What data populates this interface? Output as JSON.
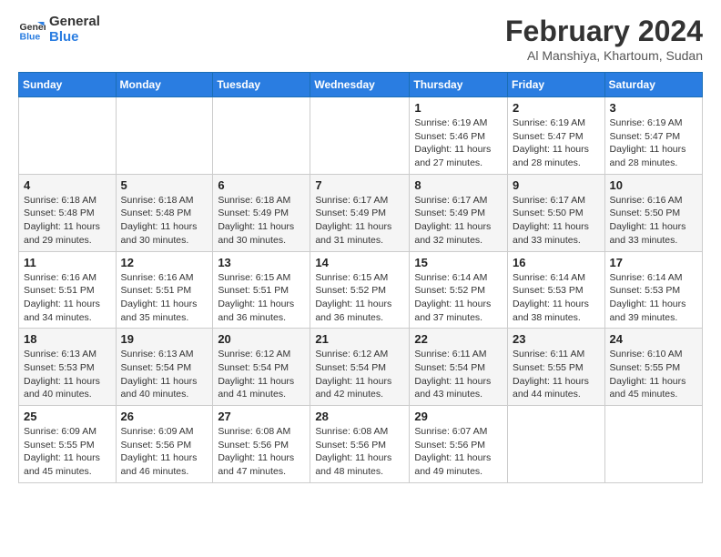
{
  "header": {
    "logo_line1": "General",
    "logo_line2": "Blue",
    "month_year": "February 2024",
    "location": "Al Manshiya, Khartoum, Sudan"
  },
  "weekdays": [
    "Sunday",
    "Monday",
    "Tuesday",
    "Wednesday",
    "Thursday",
    "Friday",
    "Saturday"
  ],
  "weeks": [
    [
      {
        "day": "",
        "info": ""
      },
      {
        "day": "",
        "info": ""
      },
      {
        "day": "",
        "info": ""
      },
      {
        "day": "",
        "info": ""
      },
      {
        "day": "1",
        "info": "Sunrise: 6:19 AM\nSunset: 5:46 PM\nDaylight: 11 hours\nand 27 minutes."
      },
      {
        "day": "2",
        "info": "Sunrise: 6:19 AM\nSunset: 5:47 PM\nDaylight: 11 hours\nand 28 minutes."
      },
      {
        "day": "3",
        "info": "Sunrise: 6:19 AM\nSunset: 5:47 PM\nDaylight: 11 hours\nand 28 minutes."
      }
    ],
    [
      {
        "day": "4",
        "info": "Sunrise: 6:18 AM\nSunset: 5:48 PM\nDaylight: 11 hours\nand 29 minutes."
      },
      {
        "day": "5",
        "info": "Sunrise: 6:18 AM\nSunset: 5:48 PM\nDaylight: 11 hours\nand 30 minutes."
      },
      {
        "day": "6",
        "info": "Sunrise: 6:18 AM\nSunset: 5:49 PM\nDaylight: 11 hours\nand 30 minutes."
      },
      {
        "day": "7",
        "info": "Sunrise: 6:17 AM\nSunset: 5:49 PM\nDaylight: 11 hours\nand 31 minutes."
      },
      {
        "day": "8",
        "info": "Sunrise: 6:17 AM\nSunset: 5:49 PM\nDaylight: 11 hours\nand 32 minutes."
      },
      {
        "day": "9",
        "info": "Sunrise: 6:17 AM\nSunset: 5:50 PM\nDaylight: 11 hours\nand 33 minutes."
      },
      {
        "day": "10",
        "info": "Sunrise: 6:16 AM\nSunset: 5:50 PM\nDaylight: 11 hours\nand 33 minutes."
      }
    ],
    [
      {
        "day": "11",
        "info": "Sunrise: 6:16 AM\nSunset: 5:51 PM\nDaylight: 11 hours\nand 34 minutes."
      },
      {
        "day": "12",
        "info": "Sunrise: 6:16 AM\nSunset: 5:51 PM\nDaylight: 11 hours\nand 35 minutes."
      },
      {
        "day": "13",
        "info": "Sunrise: 6:15 AM\nSunset: 5:51 PM\nDaylight: 11 hours\nand 36 minutes."
      },
      {
        "day": "14",
        "info": "Sunrise: 6:15 AM\nSunset: 5:52 PM\nDaylight: 11 hours\nand 36 minutes."
      },
      {
        "day": "15",
        "info": "Sunrise: 6:14 AM\nSunset: 5:52 PM\nDaylight: 11 hours\nand 37 minutes."
      },
      {
        "day": "16",
        "info": "Sunrise: 6:14 AM\nSunset: 5:53 PM\nDaylight: 11 hours\nand 38 minutes."
      },
      {
        "day": "17",
        "info": "Sunrise: 6:14 AM\nSunset: 5:53 PM\nDaylight: 11 hours\nand 39 minutes."
      }
    ],
    [
      {
        "day": "18",
        "info": "Sunrise: 6:13 AM\nSunset: 5:53 PM\nDaylight: 11 hours\nand 40 minutes."
      },
      {
        "day": "19",
        "info": "Sunrise: 6:13 AM\nSunset: 5:54 PM\nDaylight: 11 hours\nand 40 minutes."
      },
      {
        "day": "20",
        "info": "Sunrise: 6:12 AM\nSunset: 5:54 PM\nDaylight: 11 hours\nand 41 minutes."
      },
      {
        "day": "21",
        "info": "Sunrise: 6:12 AM\nSunset: 5:54 PM\nDaylight: 11 hours\nand 42 minutes."
      },
      {
        "day": "22",
        "info": "Sunrise: 6:11 AM\nSunset: 5:54 PM\nDaylight: 11 hours\nand 43 minutes."
      },
      {
        "day": "23",
        "info": "Sunrise: 6:11 AM\nSunset: 5:55 PM\nDaylight: 11 hours\nand 44 minutes."
      },
      {
        "day": "24",
        "info": "Sunrise: 6:10 AM\nSunset: 5:55 PM\nDaylight: 11 hours\nand 45 minutes."
      }
    ],
    [
      {
        "day": "25",
        "info": "Sunrise: 6:09 AM\nSunset: 5:55 PM\nDaylight: 11 hours\nand 45 minutes."
      },
      {
        "day": "26",
        "info": "Sunrise: 6:09 AM\nSunset: 5:56 PM\nDaylight: 11 hours\nand 46 minutes."
      },
      {
        "day": "27",
        "info": "Sunrise: 6:08 AM\nSunset: 5:56 PM\nDaylight: 11 hours\nand 47 minutes."
      },
      {
        "day": "28",
        "info": "Sunrise: 6:08 AM\nSunset: 5:56 PM\nDaylight: 11 hours\nand 48 minutes."
      },
      {
        "day": "29",
        "info": "Sunrise: 6:07 AM\nSunset: 5:56 PM\nDaylight: 11 hours\nand 49 minutes."
      },
      {
        "day": "",
        "info": ""
      },
      {
        "day": "",
        "info": ""
      }
    ]
  ]
}
